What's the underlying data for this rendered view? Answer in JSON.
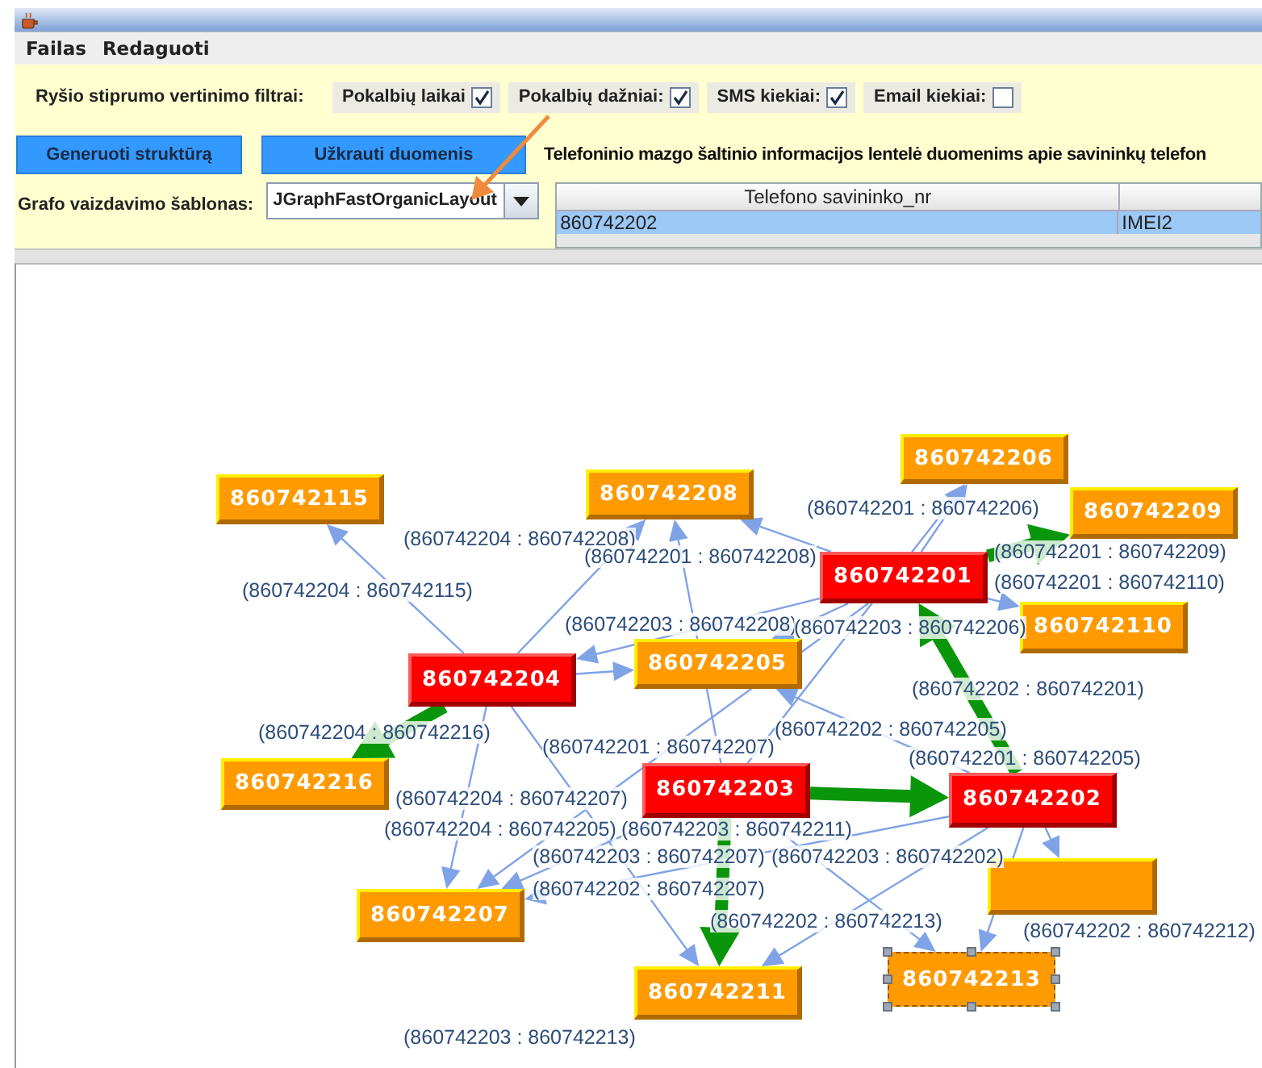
{
  "menu": [
    "Failas",
    "Redaguoti"
  ],
  "filters": {
    "label": "Ryšio stiprumo vertinimo filtrai:",
    "options": [
      {
        "label": "Pokalbių laikai",
        "checked": true
      },
      {
        "label": "Pokalbių dažniai:",
        "checked": true
      },
      {
        "label": "SMS kiekiai:",
        "checked": true
      },
      {
        "label": "Email kiekiai:",
        "checked": false
      }
    ]
  },
  "buttons": [
    "Generuoti struktūrą",
    "Užkrauti duomenis"
  ],
  "layout_select": {
    "label": "Grafo vaizdavimo šablonas:",
    "value": "JGraphFastOrganicLayout"
  },
  "table": {
    "title": "Telefoninio mazgo šaltinio informacijos lentelė duomenims apie savininkų telefon",
    "columns": [
      "Telefono savininko_nr"
    ],
    "rows": [
      {
        "cells": [
          "860742202",
          "IMEI2"
        ],
        "selected": true
      }
    ]
  },
  "graph": {
    "nodes": [
      {
        "label": "860742115",
        "kind": "contact",
        "selected": false
      },
      {
        "label": "860742208",
        "kind": "contact",
        "selected": false
      },
      {
        "label": "860742206",
        "kind": "contact",
        "selected": false
      },
      {
        "label": "860742209",
        "kind": "contact",
        "selected": false
      },
      {
        "label": "860742201",
        "kind": "owner",
        "selected": false
      },
      {
        "label": "860742110",
        "kind": "contact",
        "selected": false
      },
      {
        "label": "860742204",
        "kind": "owner",
        "selected": false
      },
      {
        "label": "860742205",
        "kind": "contact",
        "selected": false
      },
      {
        "label": "860742216",
        "kind": "contact",
        "selected": false
      },
      {
        "label": "860742203",
        "kind": "owner",
        "selected": false
      },
      {
        "label": "860742202",
        "kind": "owner",
        "selected": false
      },
      {
        "kind": "contact",
        "selected": false
      },
      {
        "label": "860742207",
        "kind": "contact",
        "selected": false
      },
      {
        "label": "860742211",
        "kind": "contact",
        "selected": false
      },
      {
        "label": "860742213",
        "kind": "contact",
        "selected": true
      }
    ],
    "edges": [
      {
        "label": "(860742204 : 860742115)",
        "kind": "weak"
      },
      {
        "label": "(860742204 : 860742208)",
        "kind": "weak"
      },
      {
        "label": "(860742201 : 860742208)",
        "kind": "weak"
      },
      {
        "label": "(860742201 : 860742206)",
        "kind": "weak"
      },
      {
        "label": "(860742201 : 860742209)",
        "kind": "strong"
      },
      {
        "label": "(860742201 : 860742110)",
        "kind": "weak"
      },
      {
        "label": "(860742203 : 860742208)",
        "kind": "weak"
      },
      {
        "label": "(860742203 : 860742206)",
        "kind": "weak"
      },
      {
        "label": "(860742202 : 860742201)",
        "kind": "strong"
      },
      {
        "label": "(860742202 : 860742205)",
        "kind": "weak"
      },
      {
        "label": "(860742201 : 860742205)",
        "kind": "weak"
      },
      {
        "label": "(860742201 : 860742207)",
        "kind": "weak"
      },
      {
        "label": "(860742204 : 860742216)",
        "kind": "strong"
      },
      {
        "label": "(860742204 : 860742207)",
        "kind": "weak"
      },
      {
        "label": "(860742204 : 860742205)",
        "kind": "weak"
      },
      {
        "label": "(860742203 : 860742211)",
        "kind": "strong"
      },
      {
        "label": "(860742203 : 860742207)",
        "kind": "weak"
      },
      {
        "label": "(860742203 : 860742202)",
        "kind": "strong"
      },
      {
        "label": "(860742202 : 860742212)",
        "kind": "weak"
      },
      {
        "label": "(860742202 : 860742207)",
        "kind": "weak"
      },
      {
        "label": "(860742202 : 860742213)",
        "kind": "weak"
      },
      {
        "label": "(860742203 : 860742213)",
        "kind": "weak"
      },
      {
        "kind": "weak"
      },
      {
        "kind": "weak"
      },
      {
        "kind": "weak"
      }
    ]
  }
}
